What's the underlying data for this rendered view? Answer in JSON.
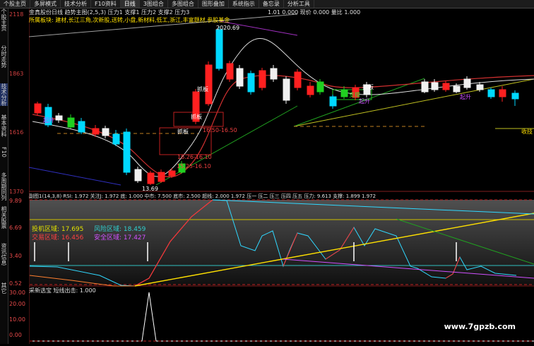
{
  "topbar": {
    "tabs": [
      "个股主页",
      "多屏模式",
      "技术分析",
      "F10资料",
      "日线",
      "3图组合",
      "多图组合",
      "图形叠加",
      "系统指示",
      "备忘录",
      "分析工具"
    ]
  },
  "sidebar": {
    "items": [
      "个股主页",
      "分时走势",
      "技术分析",
      "基本资料",
      "F10",
      "多周期同列",
      "相关股票",
      "资讯信息",
      "其它"
    ]
  },
  "main_header": {
    "line1": "金真股份日线  趋势主图(2,5,3) 压力1  支撑1  压力2  支撑2  压力3",
    "line1_right": "1.01 0.000  现价 0.000  量比 1.000",
    "line2": "所属板块: 建材,长江三角,次新股,送转,小盘,新材料,低工,浙江,丰富题材,参股基金"
  },
  "price_axis": {
    "labels": [
      "2118",
      "1863",
      "1616",
      "1370"
    ]
  },
  "price_annotations": {
    "high": "2020.69",
    "box1": "抓板",
    "box2": "抓板",
    "box3": "抓板",
    "box4": "抓板",
    "range1": "16.50-16.50",
    "range2": "16.26-16.10",
    "range3": "15.25-16.10",
    "low": "13.69",
    "qishi1": "起升",
    "qishi2": "起升",
    "qishi3": "起升",
    "qishi4": "起升",
    "zhicheng": "支撑",
    "shouji": "收技"
  },
  "indicator": {
    "header": "副图1(14,3,8) RSI: 1.972  关注J: 1.972  底: 1.000  中市: 7.500  底市: 2.500  超线: 2.000  1.972  压一  压二  压三  压四  压五  压力: 9.613  支撑: 1.899  1.972",
    "axis_labels": [
      "9.89",
      "6.69",
      "3.40",
      "0.52"
    ],
    "tiaoji": "投机区域: 17.695",
    "fengxian": "风险区域: 18.459",
    "jiaoyi": "交易区域: 16.456",
    "anquan": "安全区域: 17.427"
  },
  "bottom": {
    "header": "采新选宝  短线出击: 1.000",
    "axis_labels": [
      "30.00",
      "20.00",
      "10.00",
      "0.00"
    ]
  },
  "watermark": "www.7gpzb.com",
  "colors": {
    "up": "#ff2020",
    "down": "#00e0ff",
    "bg": "#000000"
  }
}
